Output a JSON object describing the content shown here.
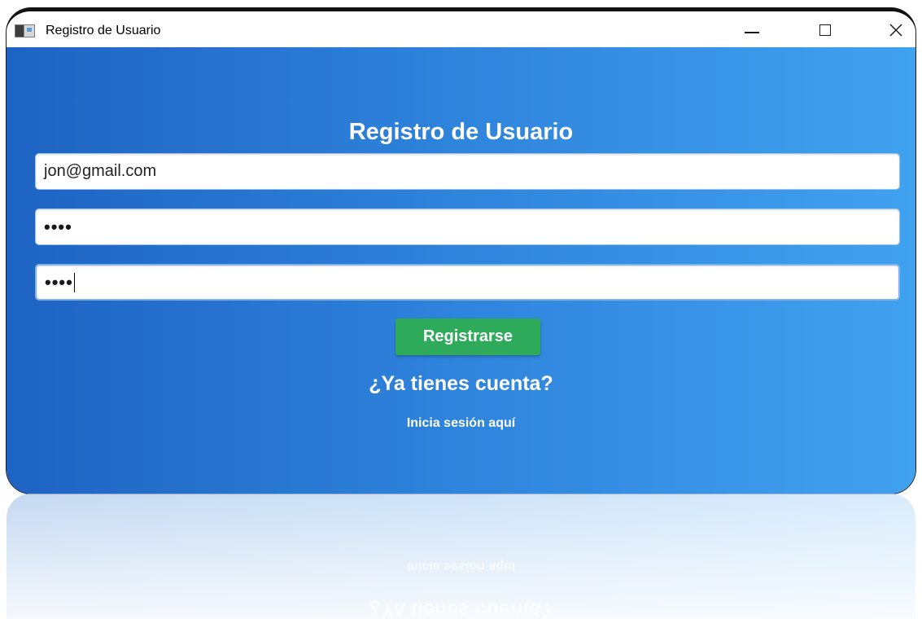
{
  "window": {
    "title": "Registro de Usuario"
  },
  "form": {
    "title": "Registro de Usuario",
    "email_value": "jon@gmail.com",
    "password_value": "••••",
    "confirm_password_value": "••••",
    "register_label": "Registrarse",
    "have_account_text": "¿Ya tienes cuenta?",
    "login_link_text": "Inicia sesión aquí"
  },
  "colors": {
    "gradient_start": "#1e63c3",
    "gradient_end": "#41a2f0",
    "register_button": "#2dab5a",
    "text": "#ffffff"
  },
  "icons": {
    "app": "app-window-icon",
    "minimize": "minimize-icon",
    "maximize": "maximize-icon",
    "close": "close-icon"
  }
}
